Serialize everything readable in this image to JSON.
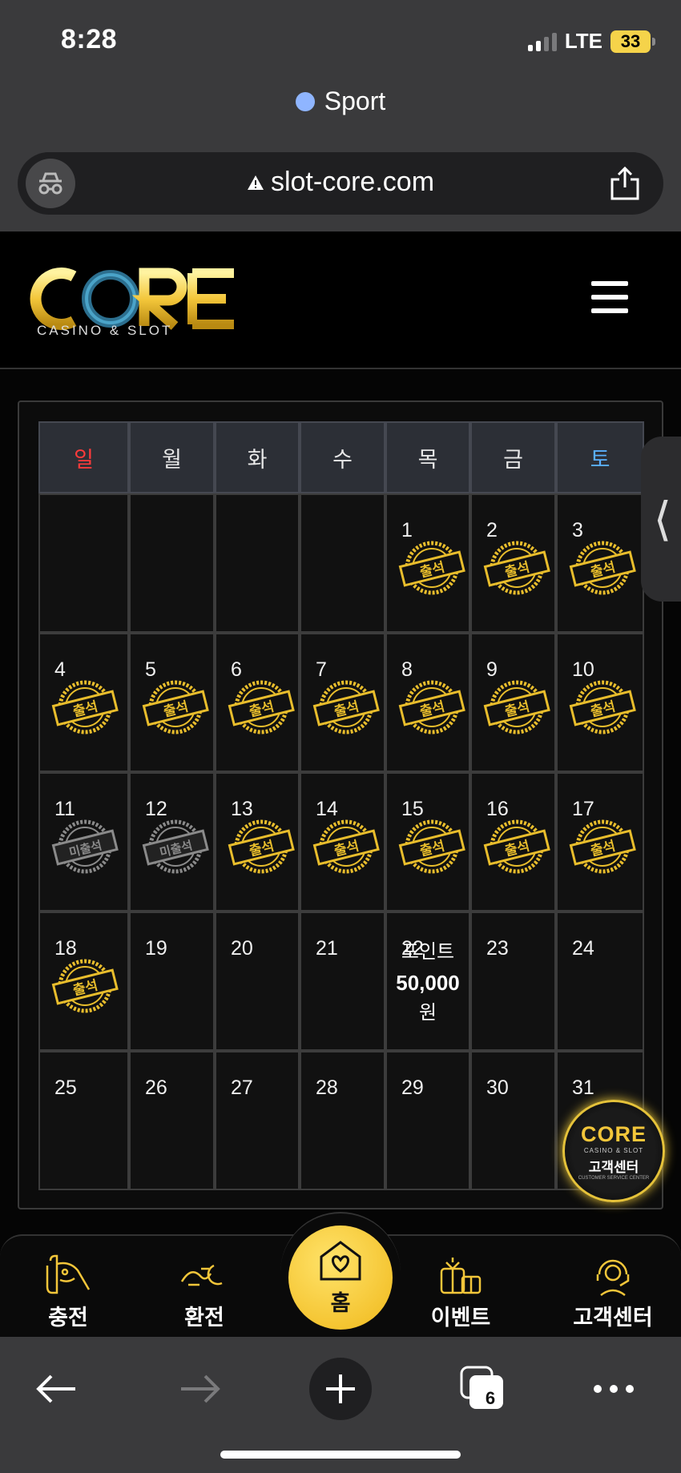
{
  "status_bar": {
    "time": "8:28",
    "network": "LTE",
    "battery": "33"
  },
  "browser": {
    "tab_title": "Sport",
    "url": "slot-core.com",
    "tabs_count": "6"
  },
  "site": {
    "logo_text": "CORE",
    "logo_subtitle": "CASINO & SLOT"
  },
  "calendar": {
    "weekdays": [
      "일",
      "월",
      "화",
      "수",
      "목",
      "금",
      "토"
    ],
    "stamp_attended": "출석",
    "stamp_absent": "미출석",
    "weeks": [
      [
        {
          "day": ""
        },
        {
          "day": ""
        },
        {
          "day": ""
        },
        {
          "day": ""
        },
        {
          "day": "1",
          "stamp": "attended"
        },
        {
          "day": "2",
          "stamp": "attended"
        },
        {
          "day": "3",
          "stamp": "attended"
        }
      ],
      [
        {
          "day": "4",
          "stamp": "attended"
        },
        {
          "day": "5",
          "stamp": "attended"
        },
        {
          "day": "6",
          "stamp": "attended"
        },
        {
          "day": "7",
          "stamp": "attended"
        },
        {
          "day": "8",
          "stamp": "attended"
        },
        {
          "day": "9",
          "stamp": "attended"
        },
        {
          "day": "10",
          "stamp": "attended"
        }
      ],
      [
        {
          "day": "11",
          "stamp": "absent"
        },
        {
          "day": "12",
          "stamp": "absent"
        },
        {
          "day": "13",
          "stamp": "attended"
        },
        {
          "day": "14",
          "stamp": "attended"
        },
        {
          "day": "15",
          "stamp": "attended"
        },
        {
          "day": "16",
          "stamp": "attended"
        },
        {
          "day": "17",
          "stamp": "attended"
        }
      ],
      [
        {
          "day": "18",
          "stamp": "attended"
        },
        {
          "day": "19"
        },
        {
          "day": "20"
        },
        {
          "day": "21"
        },
        {
          "day": "22",
          "point_label": "포인트",
          "point_amount": "50,000",
          "point_unit": "원"
        },
        {
          "day": "23"
        },
        {
          "day": "24"
        }
      ],
      [
        {
          "day": "25"
        },
        {
          "day": "26"
        },
        {
          "day": "27"
        },
        {
          "day": "28"
        },
        {
          "day": "29"
        },
        {
          "day": "30"
        },
        {
          "day": "31"
        }
      ]
    ]
  },
  "support_float": {
    "logo": "CORE",
    "subtitle": "CASINO & SLOT",
    "label": "고객센터",
    "en_label": "CUSTOMER SERVICE CENTER"
  },
  "bottom_nav": {
    "charge": "충전",
    "exchange": "환전",
    "home": "홈",
    "event": "이벤트",
    "support": "고객센터"
  },
  "colors": {
    "gold": "#f3c63a",
    "sunday": "#ff3b3b",
    "saturday": "#5ab0ff"
  },
  "icons": {
    "share": "share-icon",
    "privacy": "incognito-icon",
    "menu": "hamburger-icon"
  }
}
